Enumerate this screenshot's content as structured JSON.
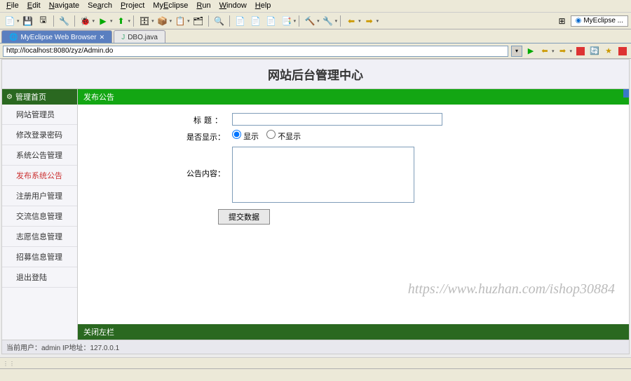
{
  "ide": {
    "menus": [
      "File",
      "Edit",
      "Navigate",
      "Search",
      "Project",
      "MyEclipse",
      "Run",
      "Window",
      "Help"
    ],
    "tabs": {
      "active": "MyEclipse Web Browser",
      "inactive": "DBO.java"
    },
    "perspective": "MyEclipse ..."
  },
  "address_bar": {
    "url": "http://localhost:8080/zyz/Admin.do"
  },
  "page": {
    "title": "网站后台管理中心"
  },
  "sidebar": {
    "header": "管理首页",
    "items": [
      "网站管理员",
      "修改登录密码",
      "系统公告管理",
      "发布系统公告",
      "注册用户管理",
      "交流信息管理",
      "志愿信息管理",
      "招募信息管理",
      "退出登陆"
    ],
    "active_index": 3
  },
  "content": {
    "header": "发布公告",
    "form": {
      "title_label": "标题：",
      "title_value": "",
      "show_label": "是否显示：",
      "show_yes": "显示",
      "show_no": "不显示",
      "body_label": "公告内容：",
      "body_value": "",
      "submit": "提交数据"
    },
    "footer": "关闭左栏"
  },
  "watermark": "https://www.huzhan.com/ishop30884",
  "status_bar": {
    "text": "当前用户：admin  IP地址：127.0.0.1"
  }
}
